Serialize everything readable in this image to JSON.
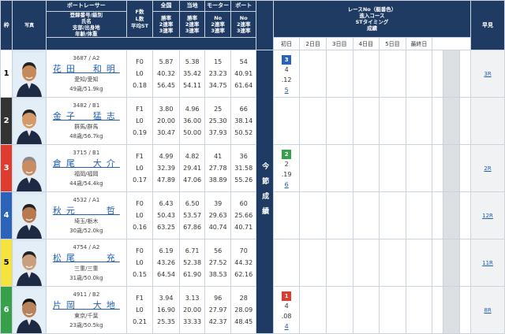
{
  "header": {
    "waku": "枠",
    "photo": "写真",
    "racer": "ボートレーサー",
    "racer_sub": [
      "登録番号/級別",
      "氏名",
      "支部/出身地",
      "年齢/体重"
    ],
    "f_col": [
      "F数",
      "L数",
      "平均ST"
    ],
    "zenkoku": "全国",
    "touchi": "当地",
    "motor": "モーター",
    "boat": "ボート",
    "rate_labels": [
      "勝率",
      "2連率",
      "3連率"
    ],
    "no_labels": [
      "No",
      "2連率",
      "3連率"
    ],
    "race_header": [
      "レースNo（艇番色）",
      "進入コース",
      "STタイミング",
      "成績"
    ],
    "days": [
      "初日",
      "2日目",
      "3日目",
      "4日目",
      "5日目",
      "最終日"
    ],
    "zenken": "早見",
    "konsetsu": "今節成績"
  },
  "boats": [
    {
      "waku": "1",
      "id": "3687 / A2",
      "name": "花田　和明",
      "branch": "愛知/愛知",
      "age": "49歳/51.9kg",
      "f": [
        "F0",
        "L0",
        "0.18"
      ],
      "zen": [
        "5.87",
        "40.32",
        "56.45"
      ],
      "tou": [
        "5.38",
        "35.42",
        "54.11"
      ],
      "motor": [
        "15",
        "23.23",
        "34.75"
      ],
      "boat": [
        "54",
        "40.91",
        "61.64"
      ],
      "race": {
        "badge": "3",
        "badge_color": "#2a63b8",
        "course": "4",
        "st": ".12",
        "rank": "5"
      },
      "hayami": "3R"
    },
    {
      "waku": "2",
      "id": "3482 / B1",
      "name": "金子　猛志",
      "branch": "群馬/群馬",
      "age": "48歳/56.7kg",
      "f": [
        "F1",
        "L0",
        "0.19"
      ],
      "zen": [
        "3.80",
        "20.00",
        "30.47"
      ],
      "tou": [
        "4.96",
        "36.00",
        "50.00"
      ],
      "motor": [
        "25",
        "25.30",
        "37.93"
      ],
      "boat": [
        "66",
        "38.14",
        "50.52"
      ],
      "race": null,
      "hayami": ""
    },
    {
      "waku": "3",
      "id": "3715 / B1",
      "name": "倉尾　大介",
      "branch": "福岡/福岡",
      "age": "44歳/54.4kg",
      "f": [
        "F1",
        "L0",
        "0.17"
      ],
      "zen": [
        "4.99",
        "32.39",
        "47.89"
      ],
      "tou": [
        "4.82",
        "29.41",
        "47.06"
      ],
      "motor": [
        "27.78",
        "38.89"
      ],
      "motor_no": "41",
      "boat": [
        "36",
        "31.58",
        "55.26"
      ],
      "race": {
        "badge": "2",
        "badge_color": "#36a04a",
        "course": "2",
        "st": ".19",
        "rank": "6"
      },
      "hayami": "2R"
    },
    {
      "waku": "4",
      "id": "4532 / A1",
      "name": "秋元　　哲",
      "branch": "埼玉/栃木",
      "age": "30歳/52.0kg",
      "f": [
        "F0",
        "L0",
        "0.16"
      ],
      "zen": [
        "6.43",
        "50.43",
        "63.25"
      ],
      "tou": [
        "6.50",
        "53.57",
        "67.86"
      ],
      "motor": [
        "39",
        "29.63",
        "40.74"
      ],
      "boat": [
        "60",
        "25.66",
        "40.71"
      ],
      "race": null,
      "hayami": "12R"
    },
    {
      "waku": "5",
      "id": "4754 / A2",
      "name": "松尾　　充",
      "branch": "三重/三重",
      "age": "31歳/50.0kg",
      "f": [
        "F0",
        "L0",
        "0.15"
      ],
      "zen": [
        "6.19",
        "43.26",
        "64.54"
      ],
      "tou": [
        "6.71",
        "52.38",
        "61.90"
      ],
      "motor": [
        "56",
        "27.52",
        "38.53"
      ],
      "boat": [
        "70",
        "44.32",
        "62.16"
      ],
      "race": null,
      "hayami": "11R"
    },
    {
      "waku": "6",
      "id": "4911 / B2",
      "name": "片岡　大地",
      "branch": "東京/千葉",
      "age": "23歳/50.5kg",
      "f": [
        "F1",
        "L0",
        "0.21"
      ],
      "zen": [
        "3.94",
        "16.90",
        "25.35"
      ],
      "tou": [
        "3.13",
        "20.00",
        "33.33"
      ],
      "motor": [
        "96",
        "27.97",
        "42.37"
      ],
      "boat": [
        "28",
        "28.09",
        "48.45"
      ],
      "race": {
        "badge": "1",
        "badge_color": "#e03b2f",
        "course": "4",
        "st": ".08",
        "rank": "4"
      },
      "hayami": "8R"
    }
  ]
}
